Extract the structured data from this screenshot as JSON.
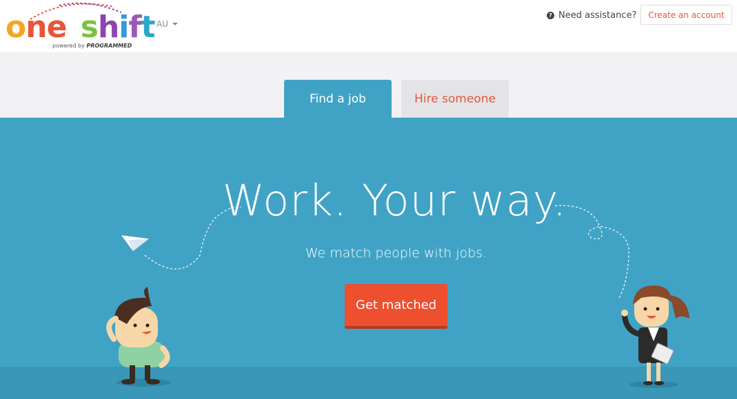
{
  "header": {
    "logo": {
      "wordmark": "one shift",
      "powered_by": "powered by",
      "powered_brand": "PROGRAMMED"
    },
    "region": "AU",
    "assistance": "Need assistance?",
    "create_account": "Create an account"
  },
  "tabs": [
    {
      "label": "Find a job",
      "active": true
    },
    {
      "label": "Hire someone",
      "active": false
    }
  ],
  "hero": {
    "title": "Work. Your way.",
    "subtitle": "We match people with jobs.",
    "cta": "Get matched"
  },
  "colors": {
    "accent": "#40a3c6",
    "cta": "#ee4f2f",
    "link": "#e8553a"
  },
  "icons": [
    "question-circle-icon",
    "caret-down-icon",
    "paper-plane-icon"
  ]
}
